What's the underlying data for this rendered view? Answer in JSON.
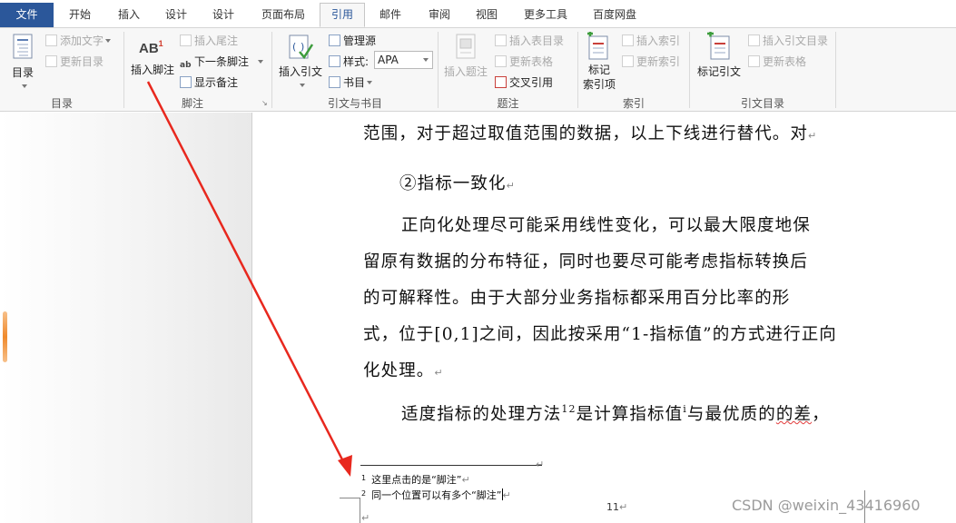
{
  "tabs": [
    {
      "label": "文件"
    },
    {
      "label": "开始"
    },
    {
      "label": "插入"
    },
    {
      "label": "设计"
    },
    {
      "label": "设计"
    },
    {
      "label": "页面布局"
    },
    {
      "label": "引用"
    },
    {
      "label": "邮件"
    },
    {
      "label": "审阅"
    },
    {
      "label": "视图"
    },
    {
      "label": "更多工具"
    },
    {
      "label": "百度网盘"
    }
  ],
  "ribbon": {
    "toc": {
      "big_label": "目录",
      "add_text": "添加文字",
      "update_toc": "更新目录",
      "group_label": "目录"
    },
    "footnotes": {
      "big_label": "插入脚注",
      "big_icon_text": "AB",
      "big_icon_sup": "1",
      "insert_endnote": "插入尾注",
      "next_footnote": "下一条脚注",
      "show_notes": "显示备注",
      "group_label": "脚注"
    },
    "citations": {
      "big_label": "插入引文",
      "manage_sources": "管理源",
      "style_label": "样式:",
      "style_value": "APA",
      "bibliography": "书目",
      "group_label": "引文与书目"
    },
    "captions": {
      "big_label": "插入题注",
      "insert_table_of_figures": "插入表目录",
      "update_table": "更新表格",
      "cross_reference": "交叉引用",
      "group_label": "题注"
    },
    "index": {
      "big_label_1": "标记",
      "big_label_2": "索引项",
      "insert_index": "插入索引",
      "update_index": "更新索引",
      "group_label": "索引"
    },
    "authorities": {
      "big_label": "标记引文",
      "insert_toa": "插入引文目录",
      "update_table": "更新表格",
      "group_label": "引文目录"
    }
  },
  "document": {
    "lines": [
      "范围，对于超过取值范围的数据，以上下线进行替代。对",
      "②指标一致化",
      "正向化处理尽可能采用线性变化，可以最大限度地保",
      "留原有数据的分布特征，同时也要尽可能考虑指标转换后",
      "的可解释性。由于大部分业务指标都采用百分比率的形",
      "式，位于[0,1]之间，因此按采用“1-指标值”的方式进行正向",
      "化处理。"
    ],
    "last_line": {
      "prefix": "适度指标的处理方法",
      "sup1": "12",
      "middle": "是计算指标值",
      "sup2": "i",
      "suffix_a": "与最优质的",
      "suffix_wavy": "的差",
      "suffix_end": "，"
    },
    "footnotes": [
      {
        "num": "1",
        "text": "这里点击的是“脚注”"
      },
      {
        "num": "2",
        "text": "同一个位置可以有多个“脚注”"
      }
    ],
    "page_number": "11"
  },
  "watermark": "CSDN @weixin_43416960",
  "colors": {
    "file_tab": "#2b579a",
    "arrow": "#e8281e",
    "accent": "#2b579a"
  }
}
